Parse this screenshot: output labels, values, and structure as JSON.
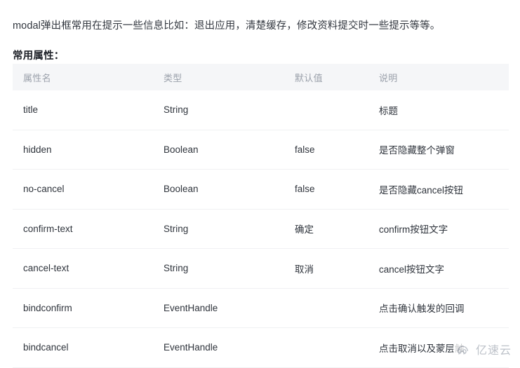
{
  "intro": {
    "paragraph": "modal弹出框常用在提示一些信息比如：退出应用，清楚缓存，修改资料提交时一些提示等等。",
    "subtitle": "常用属性："
  },
  "table": {
    "headers": {
      "name": "属性名",
      "type": "类型",
      "default": "默认值",
      "description": "说明"
    },
    "rows": [
      {
        "name": "title",
        "type": "String",
        "default": "",
        "description": "标题"
      },
      {
        "name": "hidden",
        "type": "Boolean",
        "default": "false",
        "description": "是否隐藏整个弹窗"
      },
      {
        "name": "no-cancel",
        "type": "Boolean",
        "default": "false",
        "description": "是否隐藏cancel按钮"
      },
      {
        "name": "confirm-text",
        "type": "String",
        "default": "确定",
        "description": "confirm按钮文字"
      },
      {
        "name": "cancel-text",
        "type": "String",
        "default": "取消",
        "description": "cancel按钮文字"
      },
      {
        "name": "bindconfirm",
        "type": "EventHandle",
        "default": "",
        "description": "点击确认触发的回调"
      },
      {
        "name": "bindcancel",
        "type": "EventHandle",
        "default": "",
        "description": "点击取消以及蒙层触"
      }
    ]
  },
  "watermark": {
    "text": "亿速云",
    "icon": "cloud-icon"
  },
  "colors": {
    "header_band": "#f5f6f8",
    "header_text": "#9aa0aa",
    "body_text": "#2f343c",
    "row_divider": "#f0f1f3",
    "watermark": "#a8aeb8"
  }
}
